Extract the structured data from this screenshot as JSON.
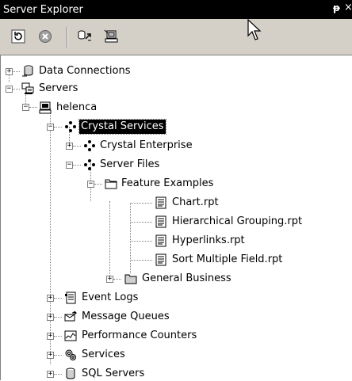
{
  "window": {
    "title": "Server Explorer",
    "pin_glyph": "ᵽ",
    "close_glyph": "×"
  },
  "toolbar": {
    "buttons": [
      {
        "name": "refresh-button",
        "icon": "refresh-icon"
      },
      {
        "name": "stop-button",
        "icon": "stop-icon"
      },
      {
        "name": "connect-to-database-button",
        "icon": "connect-database-icon"
      },
      {
        "name": "connect-to-server-button",
        "icon": "connect-server-icon"
      }
    ]
  },
  "tree": {
    "data_connections": "Data Connections",
    "servers": "Servers",
    "helenca": "helenca",
    "crystal_services": "Crystal Services",
    "crystal_enterprise": "Crystal Enterprise",
    "server_files": "Server Files",
    "feature_examples": "Feature Examples",
    "chart": "Chart.rpt",
    "hierarchical_grouping": "Hierarchical Grouping.rpt",
    "hyperlinks": "Hyperlinks.rpt",
    "sort_multiple_field": "Sort Multiple Field.rpt",
    "general_business": "General Business",
    "event_logs": "Event Logs",
    "message_queues": "Message Queues",
    "performance_counters": "Performance Counters",
    "services": "Services",
    "sql_servers": "SQL Servers"
  },
  "colors": {
    "title_bg": "#000000",
    "toolbar_bg": "#d4d0c8",
    "selection_bg": "#000000"
  }
}
